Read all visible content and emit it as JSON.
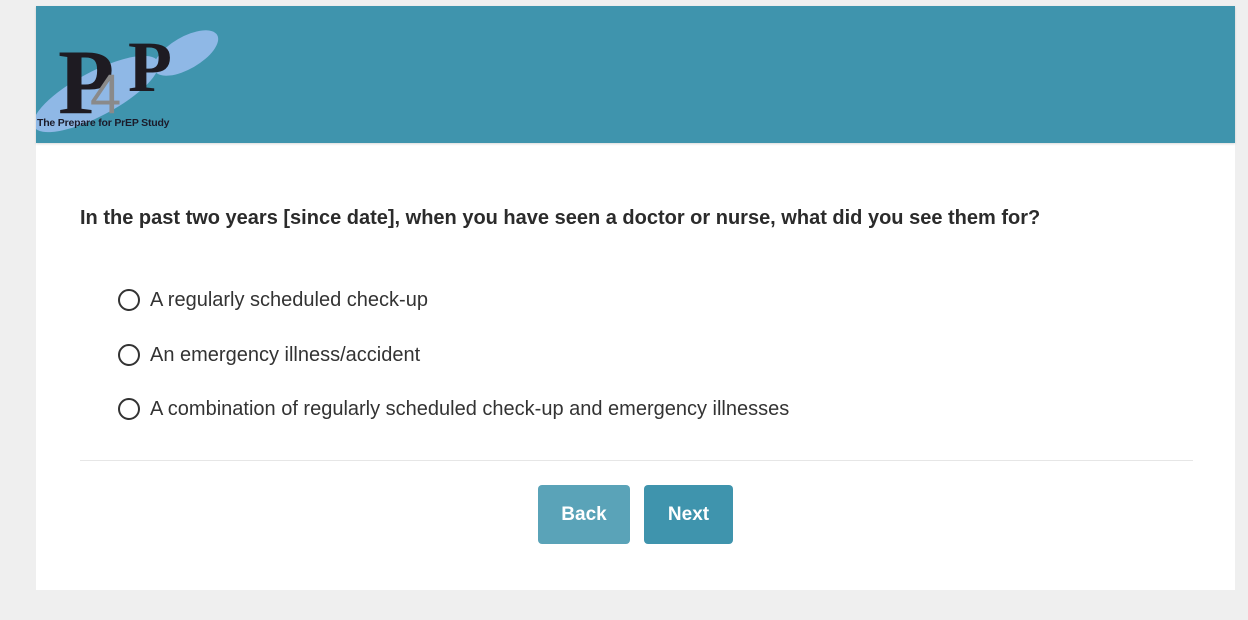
{
  "header": {
    "logo": {
      "letters_main": "P",
      "letter_overlay": "4",
      "letters_end": "P",
      "tagline": "The Prepare for PrEP Study"
    },
    "background_color": "#3f94ad"
  },
  "question": {
    "text": "In the past two years [since date], when you have seen a doctor or nurse, what did you see them for?",
    "options": [
      {
        "label": "A regularly scheduled check-up",
        "selected": false
      },
      {
        "label": "An emergency illness/accident",
        "selected": false
      },
      {
        "label": "A combination of regularly scheduled check-up and emergency illnesses",
        "selected": false
      }
    ]
  },
  "navigation": {
    "back_label": "Back",
    "next_label": "Next"
  },
  "colors": {
    "accent": "#3f94ad",
    "back_button": "#5aa3b8",
    "page_background": "#efefef"
  }
}
